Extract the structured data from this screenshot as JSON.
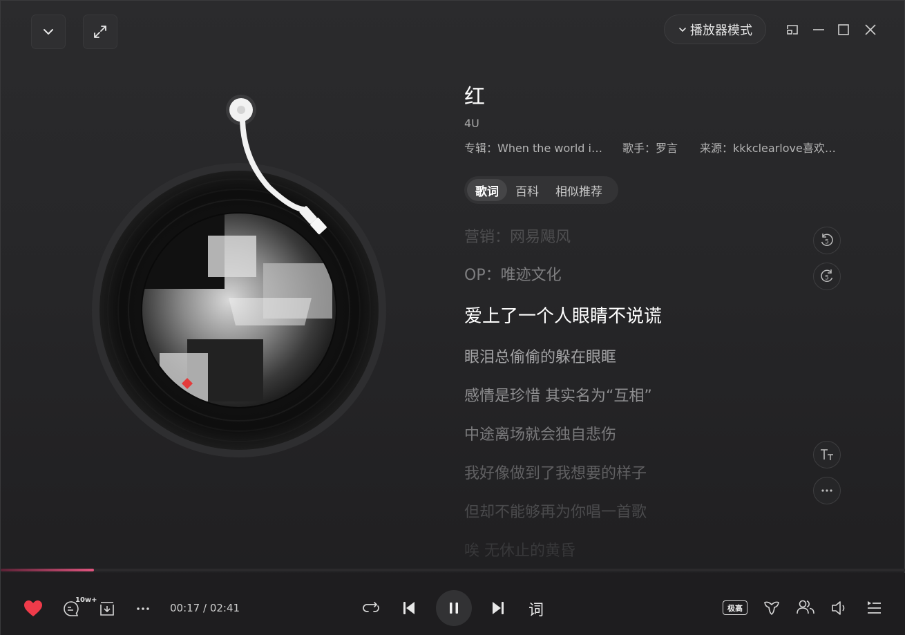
{
  "window": {
    "mode_button_label": "播放器模式"
  },
  "song": {
    "title": "红",
    "subtitle": "4U",
    "album_label": "专辑：When the world i…",
    "singer_label": "歌手：罗言",
    "source_label": "来源：kkkclearlove喜欢…"
  },
  "tabs": [
    {
      "label": "歌词",
      "active": true
    },
    {
      "label": "百科",
      "active": false
    },
    {
      "label": "相似推荐",
      "active": false
    }
  ],
  "lyrics": [
    {
      "text": "营销：网易飓风",
      "state": "past-far"
    },
    {
      "text": "OP：唯迹文化",
      "state": "past"
    },
    {
      "text": "爱上了一个人眼睛不说谎",
      "state": "current"
    },
    {
      "text": "眼泪总偷偷的躲在眼眶",
      "state": "next"
    },
    {
      "text": "感情是珍惜 其实名为“互相”",
      "state": "upcoming"
    },
    {
      "text": "中途离场就会独自悲伤",
      "state": "upcoming"
    },
    {
      "text": "我好像做到了我想要的样子",
      "state": "later"
    },
    {
      "text": "但却不能够再为你唱一首歌",
      "state": "later2"
    },
    {
      "text": "唉 无休止的黄昏",
      "state": "far"
    }
  ],
  "lyric_side_buttons": {
    "rewind_label": "5",
    "forward_label": "5"
  },
  "player": {
    "comment_badge": "10w+",
    "current_time": "00:17",
    "total_time": "02:41",
    "time_display": "00:17 / 02:41",
    "progress_fraction": 0.103,
    "lyric_toggle": "词",
    "quality_label": "极高"
  },
  "colors": {
    "accent": "#e0557f",
    "heart": "#ef3b4a"
  },
  "icons": [
    "chevron-down-icon",
    "fullscreen-icon",
    "mini-mode-icon",
    "minimize-icon",
    "maximize-icon",
    "close-icon",
    "rewind-5-icon",
    "forward-5-icon",
    "font-size-icon",
    "more-icon",
    "heart-icon",
    "comment-icon",
    "download-icon",
    "more-horizontal-icon",
    "repeat-icon",
    "previous-icon",
    "pause-icon",
    "next-icon",
    "lyric-icon",
    "quality-icon",
    "sound-effect-icon",
    "listen-together-icon",
    "volume-icon",
    "playlist-icon"
  ]
}
